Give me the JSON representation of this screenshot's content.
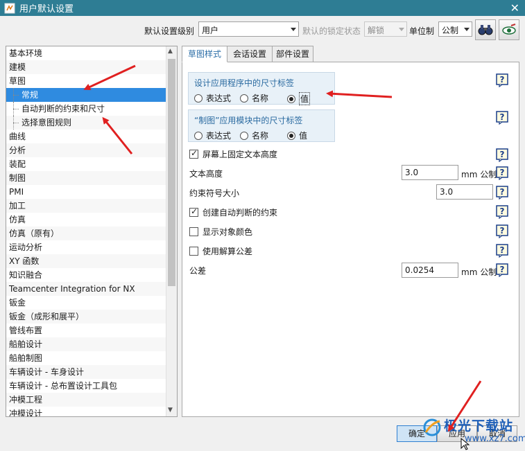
{
  "window": {
    "title": "用户默认设置",
    "close": "✕"
  },
  "toolbar": {
    "level_label": "默认设置级别",
    "level_value": "用户",
    "lock_label": "默认的锁定状态",
    "lock_value": "解锁",
    "unit_label": "单位制",
    "unit_value": "公制"
  },
  "tree": {
    "items": [
      {
        "label": "基本环境",
        "level": 0
      },
      {
        "label": "建模",
        "level": 0
      },
      {
        "label": "草图",
        "level": 0
      },
      {
        "label": "常规",
        "level": 1,
        "selected": true
      },
      {
        "label": "自动判断的约束和尺寸",
        "level": 1
      },
      {
        "label": "选择意图规则",
        "level": 1
      },
      {
        "label": "曲线",
        "level": 0
      },
      {
        "label": "分析",
        "level": 0
      },
      {
        "label": "装配",
        "level": 0
      },
      {
        "label": "制图",
        "level": 0
      },
      {
        "label": "PMI",
        "level": 0
      },
      {
        "label": "加工",
        "level": 0
      },
      {
        "label": "仿真",
        "level": 0
      },
      {
        "label": "仿真（原有）",
        "level": 0
      },
      {
        "label": "运动分析",
        "level": 0
      },
      {
        "label": "XY 函数",
        "level": 0
      },
      {
        "label": "知识融合",
        "level": 0
      },
      {
        "label": "Teamcenter Integration for NX",
        "level": 0
      },
      {
        "label": "钣金",
        "level": 0
      },
      {
        "label": "钣金（成形和展平）",
        "level": 0
      },
      {
        "label": "管线布置",
        "level": 0
      },
      {
        "label": "船舶设计",
        "level": 0
      },
      {
        "label": "船舶制图",
        "level": 0
      },
      {
        "label": "车辆设计 - 车身设计",
        "level": 0
      },
      {
        "label": "车辆设计 - 总布置设计工具包",
        "level": 0
      },
      {
        "label": "冲模工程",
        "level": 0
      },
      {
        "label": "冲模设计",
        "level": 0
      }
    ]
  },
  "tabs": [
    {
      "label": "草图样式",
      "active": true
    },
    {
      "label": "会话设置",
      "active": false
    },
    {
      "label": "部件设置",
      "active": false
    }
  ],
  "groups": [
    {
      "title": "设计应用程序中的尺寸标签",
      "options": [
        "表达式",
        "名称",
        "值"
      ],
      "selected": 2
    },
    {
      "title": "“制图”应用模块中的尺寸标签",
      "options": [
        "表达式",
        "名称",
        "值"
      ],
      "selected": 2
    }
  ],
  "settings": {
    "fixed_text_height_label": "屏幕上固定文本高度",
    "fixed_text_height_checked": true,
    "text_height_label": "文本高度",
    "text_height_value": "3.0",
    "text_height_unit": "mm 公制",
    "constraint_symbol_label": "约束符号大小",
    "constraint_symbol_value": "3.0",
    "create_constraints_label": "创建自动判断的约束",
    "create_constraints_checked": true,
    "show_object_color_label": "显示对象颜色",
    "show_object_color_checked": false,
    "use_solve_tolerance_label": "使用解算公差",
    "use_solve_tolerance_checked": false,
    "tolerance_label": "公差",
    "tolerance_value": "0.0254",
    "tolerance_unit": "mm 公制"
  },
  "help_icon": "?",
  "buttons": {
    "ok": "确定",
    "apply": "应用",
    "cancel": "取消"
  },
  "watermark": {
    "text": "极光下载站",
    "url": "www.xz7.com"
  },
  "colors": {
    "titlebar": "#2e7d94",
    "selection": "#2f8be0",
    "annotation_arrow": "#e02020"
  }
}
